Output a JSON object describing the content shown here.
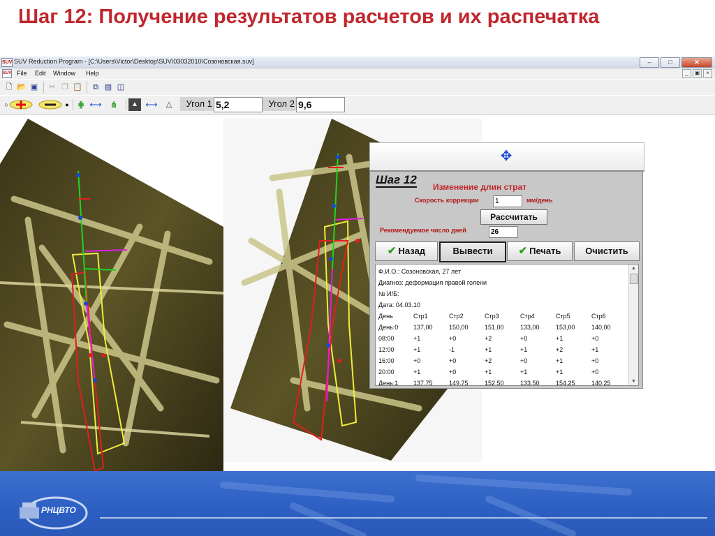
{
  "slide": {
    "title": "Шаг 12: Получение результатов расчетов и их распечатка"
  },
  "window": {
    "title": "SUV Reduction Program - [C:\\Users\\Victor\\Desktop\\SUV\\03032010\\Созоновская.suv]",
    "app_icon": "SUV",
    "controls": [
      "minimize-icon",
      "maximize-icon",
      "close-icon"
    ]
  },
  "menu": {
    "items": [
      "File",
      "Edit",
      "Window",
      "Help"
    ]
  },
  "toolbar": {
    "angle1_label": "Угол 1",
    "angle1_value": "5,2",
    "angle2_label": "Угол 2",
    "angle2_value": "9,6"
  },
  "panel": {
    "step_label": "Шаг 12",
    "title": "Изменение длин страт",
    "speed_label": "Скорость коррекции",
    "speed_value": "1",
    "speed_unit": "мм/день",
    "calc_button": "Рассчитать",
    "days_label": "Рекомендуемое число дней",
    "days_value": "26",
    "buttons": {
      "back": "Назад",
      "output": "Вывести",
      "print": "Печать",
      "clear": "Очистить"
    }
  },
  "report": {
    "fio": "Ф.И.О.:  Созоновская, 27 лет",
    "diagnosis": "Диагноз: деформация правой голени",
    "record": "№ И/Б:",
    "date": "Дата:   04.03.10",
    "columns": [
      "День",
      "Стр1",
      "Стр2",
      "Стр3",
      "Стр4",
      "Стр5",
      "Стр6"
    ],
    "rows": [
      [
        "День:0",
        "137,00",
        "150,00",
        "151,00",
        "133,00",
        "153,00",
        "140,00"
      ],
      [
        "08:00",
        "+1",
        "+0",
        "+2",
        "+0",
        "+1",
        "+0"
      ],
      [
        "12:00",
        "+1",
        "-1",
        "+1",
        "+1",
        "+2",
        "+1"
      ],
      [
        "16:00",
        "+0",
        "+0",
        "+2",
        "+0",
        "+1",
        "+0"
      ],
      [
        "20:00",
        "+1",
        "+0",
        "+1",
        "+1",
        "+1",
        "+0"
      ],
      [
        "День:1",
        "137,75",
        "149,75",
        "152,50",
        "133,50",
        "154,25",
        "140,25"
      ]
    ]
  },
  "footer": {
    "logo_text": "РНЦВТО"
  }
}
